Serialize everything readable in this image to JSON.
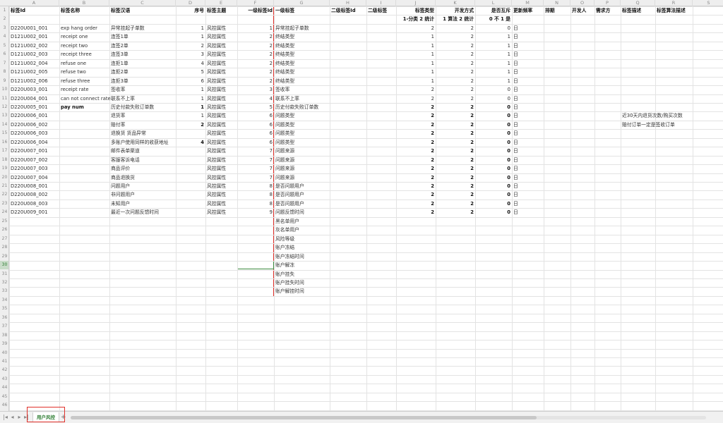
{
  "sheet": {
    "active_cell": "G30",
    "sheet_tab_label": "用户风控",
    "add_sheet_label": "+",
    "nav": [
      "|◂",
      "◂",
      "▸",
      "▸|"
    ]
  },
  "columns": [
    {
      "letter": "A",
      "w": 71
    },
    {
      "letter": "B",
      "w": 71
    },
    {
      "letter": "C",
      "w": 94
    },
    {
      "letter": "D",
      "w": 42
    },
    {
      "letter": "E",
      "w": 45
    },
    {
      "letter": "F",
      "w": 52
    },
    {
      "letter": "G",
      "w": 79
    },
    {
      "letter": "H",
      "w": 52
    },
    {
      "letter": "I",
      "w": 42
    },
    {
      "letter": "J",
      "w": 56
    },
    {
      "letter": "K",
      "w": 56
    },
    {
      "letter": "L",
      "w": 52
    },
    {
      "letter": "M",
      "w": 45
    },
    {
      "letter": "N",
      "w": 38
    },
    {
      "letter": "O",
      "w": 34
    },
    {
      "letter": "P",
      "w": 37
    },
    {
      "letter": "Q",
      "w": 49
    },
    {
      "letter": "R",
      "w": 53
    },
    {
      "letter": "S",
      "w": 46
    }
  ],
  "row_count": 46,
  "header_row1": [
    "标签Id",
    "标签名称",
    "标签汉语",
    "序号",
    "标签主题",
    "一级标签Id",
    "一级标签",
    "二级标签Id",
    "二级标签",
    "标签类型",
    "开发方式",
    "是否互斥",
    "更新频率",
    "排期",
    "开发人",
    "需求方",
    "标签描述",
    "标签算法描述",
    ""
  ],
  "header_row2": [
    "",
    "",
    "",
    "",
    "",
    "",
    "",
    "",
    "",
    "1-分类 2 统计",
    "1 算法 2 统计",
    "0 不 1 是",
    "",
    "",
    "",
    "",
    "",
    "",
    ""
  ],
  "data_rows": [
    [
      "D220U001_001",
      "exp hang order",
      "异常挂起子单数",
      "1",
      "风控属性",
      "1",
      "异常挂起子单数",
      "",
      "",
      "2",
      "2",
      "0",
      "日",
      "",
      "",
      "",
      "",
      "",
      ""
    ],
    [
      "D121U002_001",
      "receipt one",
      "连签1单",
      "1",
      "风控属性",
      "2",
      "终结类型",
      "",
      "",
      "1",
      "2",
      "1",
      "日",
      "",
      "",
      "",
      "",
      "",
      ""
    ],
    [
      "D121U002_002",
      "receipt two",
      "连签2单",
      "2",
      "风控属性",
      "2",
      "终结类型",
      "",
      "",
      "1",
      "2",
      "1",
      "日",
      "",
      "",
      "",
      "",
      "",
      ""
    ],
    [
      "D121U002_003",
      "receipt three",
      "连签3单",
      "3",
      "风控属性",
      "2",
      "终结类型",
      "",
      "",
      "1",
      "2",
      "1",
      "日",
      "",
      "",
      "",
      "",
      "",
      ""
    ],
    [
      "D121U002_004",
      "refuse one",
      "连拒1单",
      "4",
      "风控属性",
      "2",
      "终结类型",
      "",
      "",
      "1",
      "2",
      "1",
      "日",
      "",
      "",
      "",
      "",
      "",
      ""
    ],
    [
      "D121U002_005",
      "refuse two",
      "连拒2单",
      "5",
      "风控属性",
      "2",
      "终结类型",
      "",
      "",
      "1",
      "2",
      "1",
      "日",
      "",
      "",
      "",
      "",
      "",
      ""
    ],
    [
      "D121U002_006",
      "refuse three",
      "连拒3单",
      "6",
      "风控属性",
      "2",
      "终结类型",
      "",
      "",
      "1",
      "2",
      "1",
      "日",
      "",
      "",
      "",
      "",
      "",
      ""
    ],
    [
      "D220U003_001",
      "receipt rate",
      "签收率",
      "1",
      "风控属性",
      "3",
      "签收率",
      "",
      "",
      "2",
      "2",
      "0",
      "日",
      "",
      "",
      "",
      "",
      "",
      ""
    ],
    [
      "D220U004_001",
      "can not connect rate",
      "联系不上率",
      "1",
      "风控属性",
      "4",
      "联系不上率",
      "",
      "",
      "2",
      "2",
      "0",
      "日",
      "",
      "",
      "",
      "",
      "",
      ""
    ],
    [
      "D220U005_001",
      "pay num",
      "历史付款失败订单数",
      "1",
      "风控属性",
      "5",
      "历史付款失败订单数",
      "",
      "",
      "2",
      "2",
      "0",
      "日",
      "",
      "",
      "",
      "",
      "",
      ""
    ],
    [
      "D220U006_001",
      "",
      "退货率",
      "1",
      "风控属性",
      "6",
      "问题类型",
      "",
      "",
      "2",
      "2",
      "0",
      "日",
      "",
      "",
      "",
      "近30天内退货次数/购买次数",
      "",
      ""
    ],
    [
      "D220U006_002",
      "",
      "赔付率",
      "2",
      "风控属性",
      "6",
      "问题类型",
      "",
      "",
      "2",
      "2",
      "0",
      "日",
      "",
      "",
      "",
      "赔付订单一定是签收订单",
      "",
      ""
    ],
    [
      "D220U006_003",
      "",
      "退换货 货品异常",
      "",
      "风控属性",
      "6",
      "问题类型",
      "",
      "",
      "2",
      "2",
      "0",
      "日",
      "",
      "",
      "",
      "",
      "",
      ""
    ],
    [
      "D220U006_004",
      "",
      "多账户使用同样的收获地址",
      "4",
      "风控属性",
      "6",
      "问题类型",
      "",
      "",
      "2",
      "2",
      "0",
      "日",
      "",
      "",
      "",
      "",
      "",
      ""
    ],
    [
      "D220U007_001",
      "",
      "邮件表单渠道",
      "",
      "风控属性",
      "7",
      "问题来源",
      "",
      "",
      "2",
      "2",
      "0",
      "日",
      "",
      "",
      "",
      "",
      "",
      ""
    ],
    [
      "D220U007_002",
      "",
      "客服客诉电话",
      "",
      "风控属性",
      "7",
      "问题来源",
      "",
      "",
      "2",
      "2",
      "0",
      "日",
      "",
      "",
      "",
      "",
      "",
      ""
    ],
    [
      "D220U007_003",
      "",
      "商品评价",
      "",
      "风控属性",
      "7",
      "问题来源",
      "",
      "",
      "2",
      "2",
      "0",
      "日",
      "",
      "",
      "",
      "",
      "",
      ""
    ],
    [
      "D220U007_004",
      "",
      "商品退换货",
      "",
      "风控属性",
      "7",
      "问题来源",
      "",
      "",
      "2",
      "2",
      "0",
      "日",
      "",
      "",
      "",
      "",
      "",
      ""
    ],
    [
      "D220U008_001",
      "",
      "问题用户",
      "",
      "风控属性",
      "8",
      "是否问题用户",
      "",
      "",
      "2",
      "2",
      "0",
      "日",
      "",
      "",
      "",
      "",
      "",
      ""
    ],
    [
      "D220U008_002",
      "",
      "非问题用户",
      "",
      "风控属性",
      "8",
      "是否问题用户",
      "",
      "",
      "2",
      "2",
      "0",
      "日",
      "",
      "",
      "",
      "",
      "",
      ""
    ],
    [
      "D220U008_003",
      "",
      "未知用户",
      "",
      "风控属性",
      "8",
      "是否问题用户",
      "",
      "",
      "2",
      "2",
      "0",
      "日",
      "",
      "",
      "",
      "",
      "",
      ""
    ],
    [
      "D220U009_001",
      "",
      "最近一次问题反馈时间",
      "",
      "风控属性",
      "9",
      "问题反馈时间",
      "",
      "",
      "2",
      "2",
      "0",
      "日",
      "",
      "",
      "",
      "",
      "",
      ""
    ]
  ],
  "extra_g_items": [
    {
      "row": 25,
      "text": "黑名单用户"
    },
    {
      "row": 26,
      "text": "灰名单用户"
    },
    {
      "row": 27,
      "text": "风险等级"
    },
    {
      "row": 28,
      "text": "账户冻结"
    },
    {
      "row": 29,
      "text": "账户冻结时间"
    },
    {
      "row": 30,
      "text": "账户解冻"
    },
    {
      "row": 31,
      "text": "账户挂失"
    },
    {
      "row": 32,
      "text": "账户挂失时间"
    },
    {
      "row": 33,
      "text": "账户解挂时间"
    }
  ]
}
